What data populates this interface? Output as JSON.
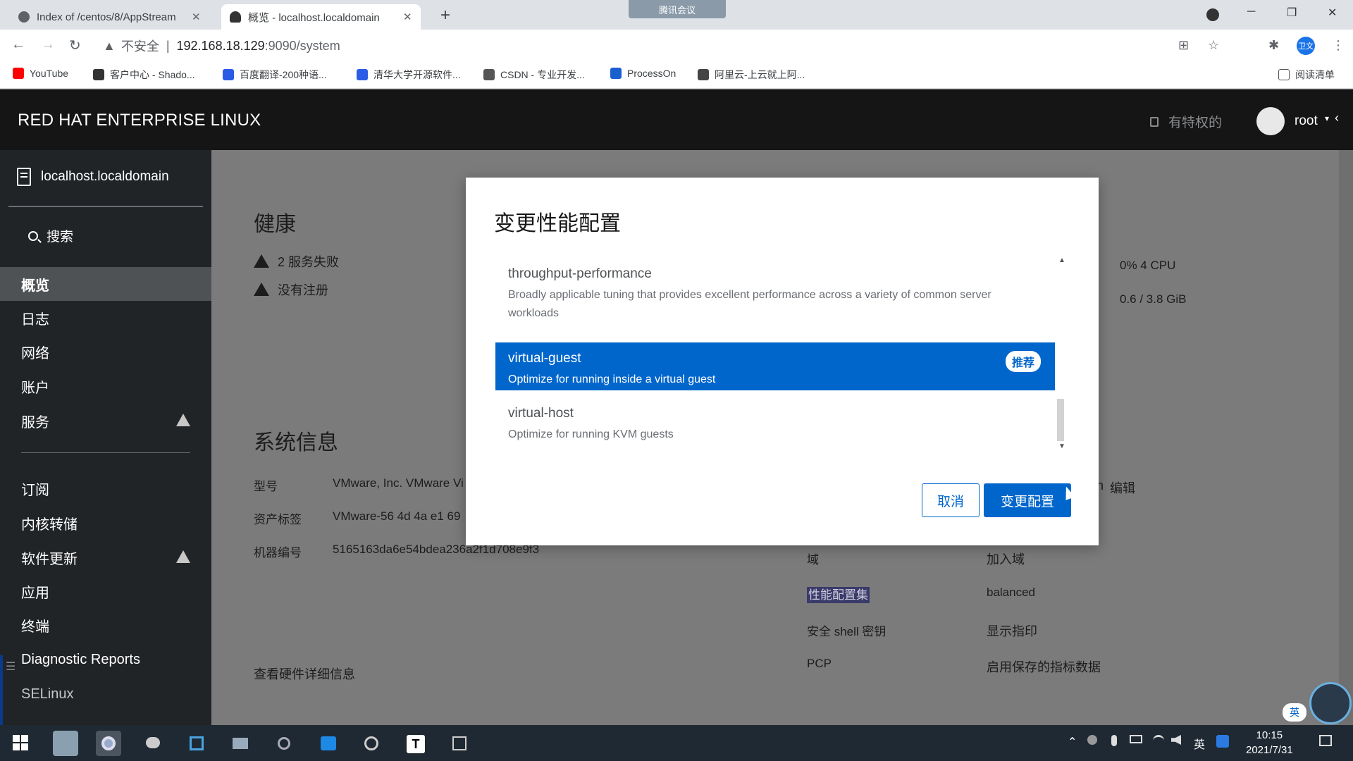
{
  "browser": {
    "tabs": [
      {
        "title": "Index of /centos/8/AppStream",
        "close": "✕"
      },
      {
        "title": "概览 - localhost.localdomain",
        "close": "✕"
      }
    ],
    "new_tab": "+",
    "meeting": "腾讯会议",
    "window_controls": [
      "─",
      "❐",
      "✕"
    ],
    "address": {
      "warning": "▲",
      "insecure": "不安全",
      "separator": "|",
      "host": "192.168.18.129",
      "path": ":9090/system"
    },
    "nav": {
      "back": "←",
      "forward": "→",
      "reload": "↻"
    },
    "toolbar_icons": {
      "translate": "⊞",
      "star": "☆",
      "extension": "✱",
      "profile": "卫文",
      "menu": "⋮"
    },
    "bookmarks": [
      {
        "label": "YouTube",
        "color": "#ff0000"
      },
      {
        "label": "客户中心 - Shado...",
        "color": "#333333"
      },
      {
        "label": "百度翻译-200种语...",
        "color": "#2b5ce6"
      },
      {
        "label": "清华大学开源软件...",
        "color": "#2b5ce6"
      },
      {
        "label": "CSDN - 专业开发...",
        "color": "#555555"
      },
      {
        "label": "ProcessOn",
        "color": "#1a5fd0"
      },
      {
        "label": "阿里云-上云就上阿...",
        "color": "#444444"
      }
    ],
    "reading_list": "阅读清单"
  },
  "app": {
    "brand": "RED HAT ENTERPRISE LINUX",
    "privileged": "有特权的",
    "user": "root",
    "caret": "▾",
    "collapse": "‹"
  },
  "sidebar": {
    "host": "localhost.localdomain",
    "search": "搜索",
    "items": [
      {
        "label": "概览",
        "active": true,
        "warn": false
      },
      {
        "label": "日志",
        "active": false,
        "warn": false
      },
      {
        "label": "网络",
        "active": false,
        "warn": false
      },
      {
        "label": "账户",
        "active": false,
        "warn": false
      },
      {
        "label": "服务",
        "active": false,
        "warn": true
      }
    ],
    "items2": [
      {
        "label": "订阅",
        "warn": false
      },
      {
        "label": "内核转储",
        "warn": false
      },
      {
        "label": "软件更新",
        "warn": true
      },
      {
        "label": "应用",
        "warn": false
      },
      {
        "label": "终端",
        "warn": false
      },
      {
        "label": "Diagnostic Reports",
        "warn": false
      },
      {
        "label": "SELinux",
        "warn": false
      }
    ]
  },
  "content": {
    "health_title": "健康",
    "health_items": [
      "2 服务失败",
      "没有注册"
    ],
    "cpu": "0% 4 CPU",
    "mem": "0.6 / 3.8 GiB",
    "sysinfo_title": "系统信息",
    "sysinfo": [
      {
        "key": "型号",
        "value": "VMware, Inc. VMware Vi"
      },
      {
        "key": "资产标签",
        "value": "VMware-56 4d 4a e1 69"
      },
      {
        "key": "机器编号",
        "value": "5165163da6e54bdea236a2f1d708e9f3"
      }
    ],
    "hardware_link": "查看硬件详细信息",
    "config": [
      {
        "key": "域",
        "value": "加入域"
      },
      {
        "key": "性能配置集",
        "value": "balanced"
      },
      {
        "key": "安全 shell 密钥",
        "value": "显示指印"
      },
      {
        "key": "PCP",
        "value": "启用保存的指标数据"
      }
    ],
    "edit_suffix": "n",
    "edit": "编辑"
  },
  "modal": {
    "title": "变更性能配置",
    "options": [
      {
        "name": "throughput-performance",
        "desc": "Broadly applicable tuning that provides excellent performance across a variety of common server workloads",
        "selected": false
      },
      {
        "name": "virtual-guest",
        "desc": "Optimize for running inside a virtual guest",
        "selected": true,
        "badge": "推荐"
      },
      {
        "name": "virtual-host",
        "desc": "Optimize for running KVM guests",
        "selected": false
      }
    ],
    "scroll_up": "▲",
    "scroll_down": "▼",
    "cancel": "取消",
    "apply": "变更配置"
  },
  "taskbar": {
    "tray": {
      "up": "⌃",
      "lang": "英"
    },
    "time": "10:15",
    "date": "2021/7/31",
    "ime_badge": "英",
    "apps": [
      "start",
      "app-1",
      "chrome",
      "wechat",
      "vmware",
      "explorer",
      "app-2",
      "app-3",
      "app-4",
      "typora",
      "app-5"
    ]
  },
  "colors": {
    "accent": "#0066cc",
    "header": "#151515",
    "sidebar": "#212427"
  }
}
